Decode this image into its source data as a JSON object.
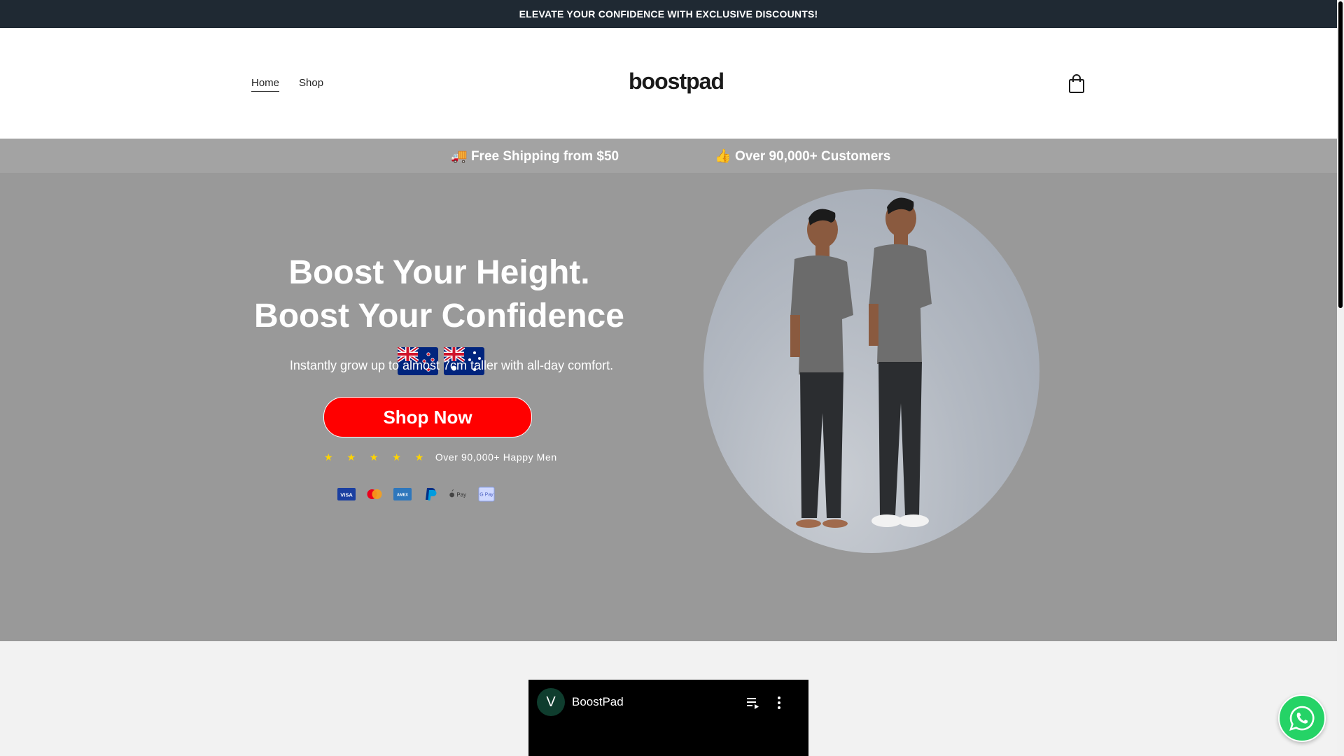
{
  "announcement": {
    "text": "ELEVATE YOUR CONFIDENCE WITH EXCLUSIVE DISCOUNTS!"
  },
  "header": {
    "nav": [
      {
        "label": "Home",
        "active": true
      },
      {
        "label": "Shop",
        "active": false
      }
    ],
    "logo": "boostpad",
    "cart_icon": "shopping-bag-icon"
  },
  "strip": {
    "items": [
      {
        "icon": "🚚",
        "text": "Free Shipping from $50"
      },
      {
        "icon": "👍",
        "text": "Over 90,000+ Customers"
      }
    ]
  },
  "hero": {
    "title": "Boost Your Height. Boost Your Confidence",
    "flags": [
      "new-zealand-flag",
      "australia-flag"
    ],
    "subtitle": "Instantly grow up to almost 7cm taller with all-day comfort.",
    "cta_label": "Shop Now",
    "rating": {
      "stars": "★ ★ ★ ★ ★",
      "text": "Over 90,000+ Happy Men",
      "star_count": 5
    },
    "payments": [
      "visa-icon",
      "mastercard-icon",
      "amex-icon",
      "paypal-icon",
      "apple-pay-icon",
      "google-pay-icon"
    ],
    "image": "two-men-height-comparison-image"
  },
  "video": {
    "avatar_letter": "V",
    "title": "BoostPad"
  },
  "colors": {
    "announcement_bg": "#1f2933",
    "strip_bg": "#a3a3a3",
    "hero_bg": "#999999",
    "cta_bg": "#ff0000",
    "star": "#ffd400",
    "whatsapp": "#25d366"
  }
}
